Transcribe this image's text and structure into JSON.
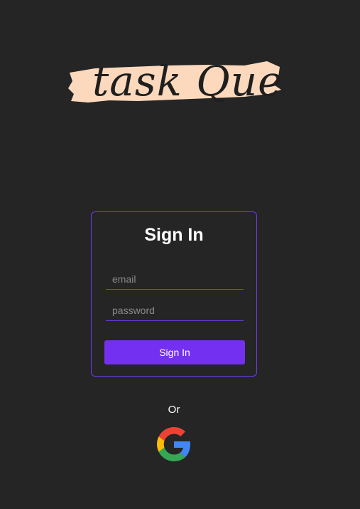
{
  "logo": {
    "text": "task Quest",
    "brush_color": "#fcd9bd",
    "text_color": "#1f1f1f"
  },
  "login_card": {
    "title": "Sign In",
    "email_placeholder": "email",
    "password_placeholder": "password",
    "submit_label": "Sign In",
    "accent_color": "#7430f0"
  },
  "alt_login": {
    "divider_text": "Or",
    "google_icon": "google-icon"
  },
  "theme": {
    "background": "#252525"
  }
}
